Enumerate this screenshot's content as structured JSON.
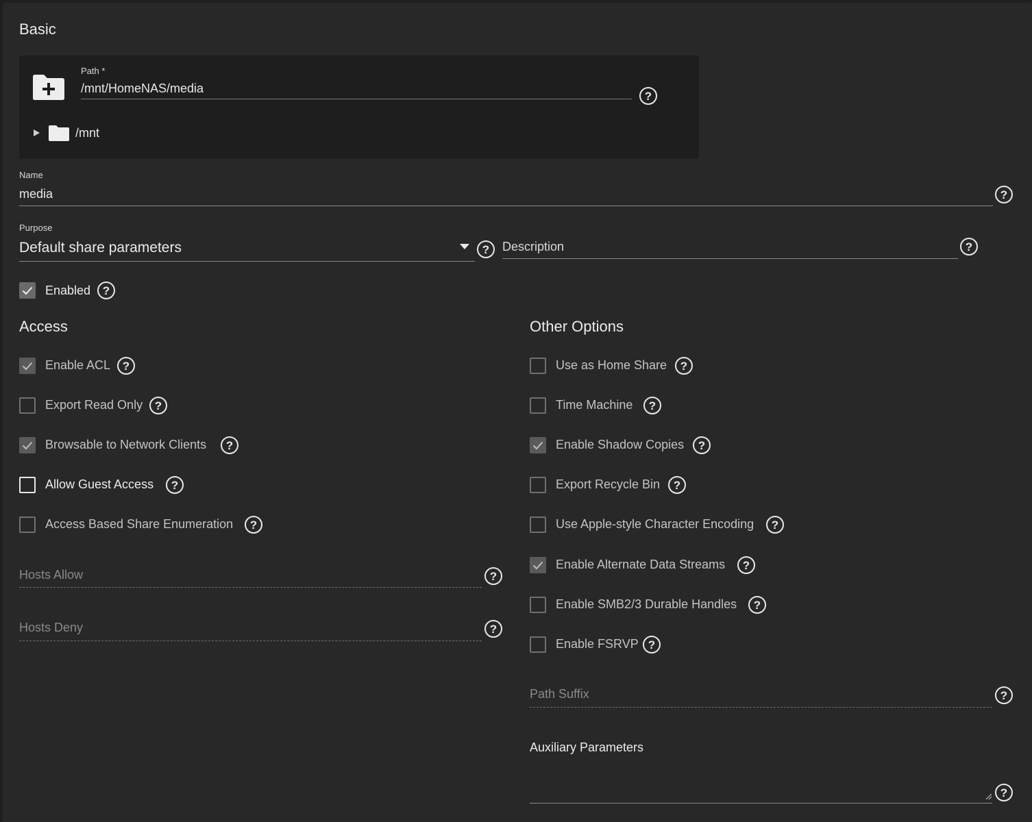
{
  "basic": {
    "title": "Basic",
    "path_label": "Path *",
    "path_value": "/mnt/HomeNAS/media",
    "tree_root": "/mnt"
  },
  "name": {
    "label": "Name",
    "value": "media"
  },
  "purpose": {
    "label": "Purpose",
    "value": "Default share parameters"
  },
  "description": {
    "placeholder": "Description"
  },
  "enabled": {
    "label": "Enabled",
    "checked": true
  },
  "access": {
    "title": "Access",
    "items": [
      {
        "label": "Enable ACL",
        "checked": true
      },
      {
        "label": "Export Read Only",
        "checked": false
      },
      {
        "label": "Browsable to Network Clients",
        "checked": true
      },
      {
        "label": "Allow Guest Access",
        "checked": false
      },
      {
        "label": "Access Based Share Enumeration",
        "checked": false
      }
    ],
    "hosts_allow": "Hosts Allow",
    "hosts_deny": "Hosts Deny"
  },
  "other": {
    "title": "Other Options",
    "items": [
      {
        "label": "Use as Home Share",
        "checked": false
      },
      {
        "label": "Time Machine",
        "checked": false
      },
      {
        "label": "Enable Shadow Copies",
        "checked": true
      },
      {
        "label": "Export Recycle Bin",
        "checked": false
      },
      {
        "label": "Use Apple-style Character Encoding",
        "checked": false
      },
      {
        "label": "Enable Alternate Data Streams",
        "checked": true
      },
      {
        "label": "Enable SMB2/3 Durable Handles",
        "checked": false
      },
      {
        "label": "Enable FSRVP",
        "checked": false
      }
    ],
    "path_suffix": "Path Suffix",
    "aux_label": "Auxiliary Parameters"
  },
  "icons": {
    "help": "help-circle-icon",
    "folder_add": "folder-plus-icon",
    "folder": "folder-icon",
    "expand": "triangle-right-icon",
    "dropdown": "caret-down-icon",
    "check": "check-icon"
  },
  "colors": {
    "background": "#1f1f1f",
    "card": "#282828",
    "panel": "#1e1e1e",
    "text": "#e6e6e6",
    "muted": "#8a8a8a"
  }
}
